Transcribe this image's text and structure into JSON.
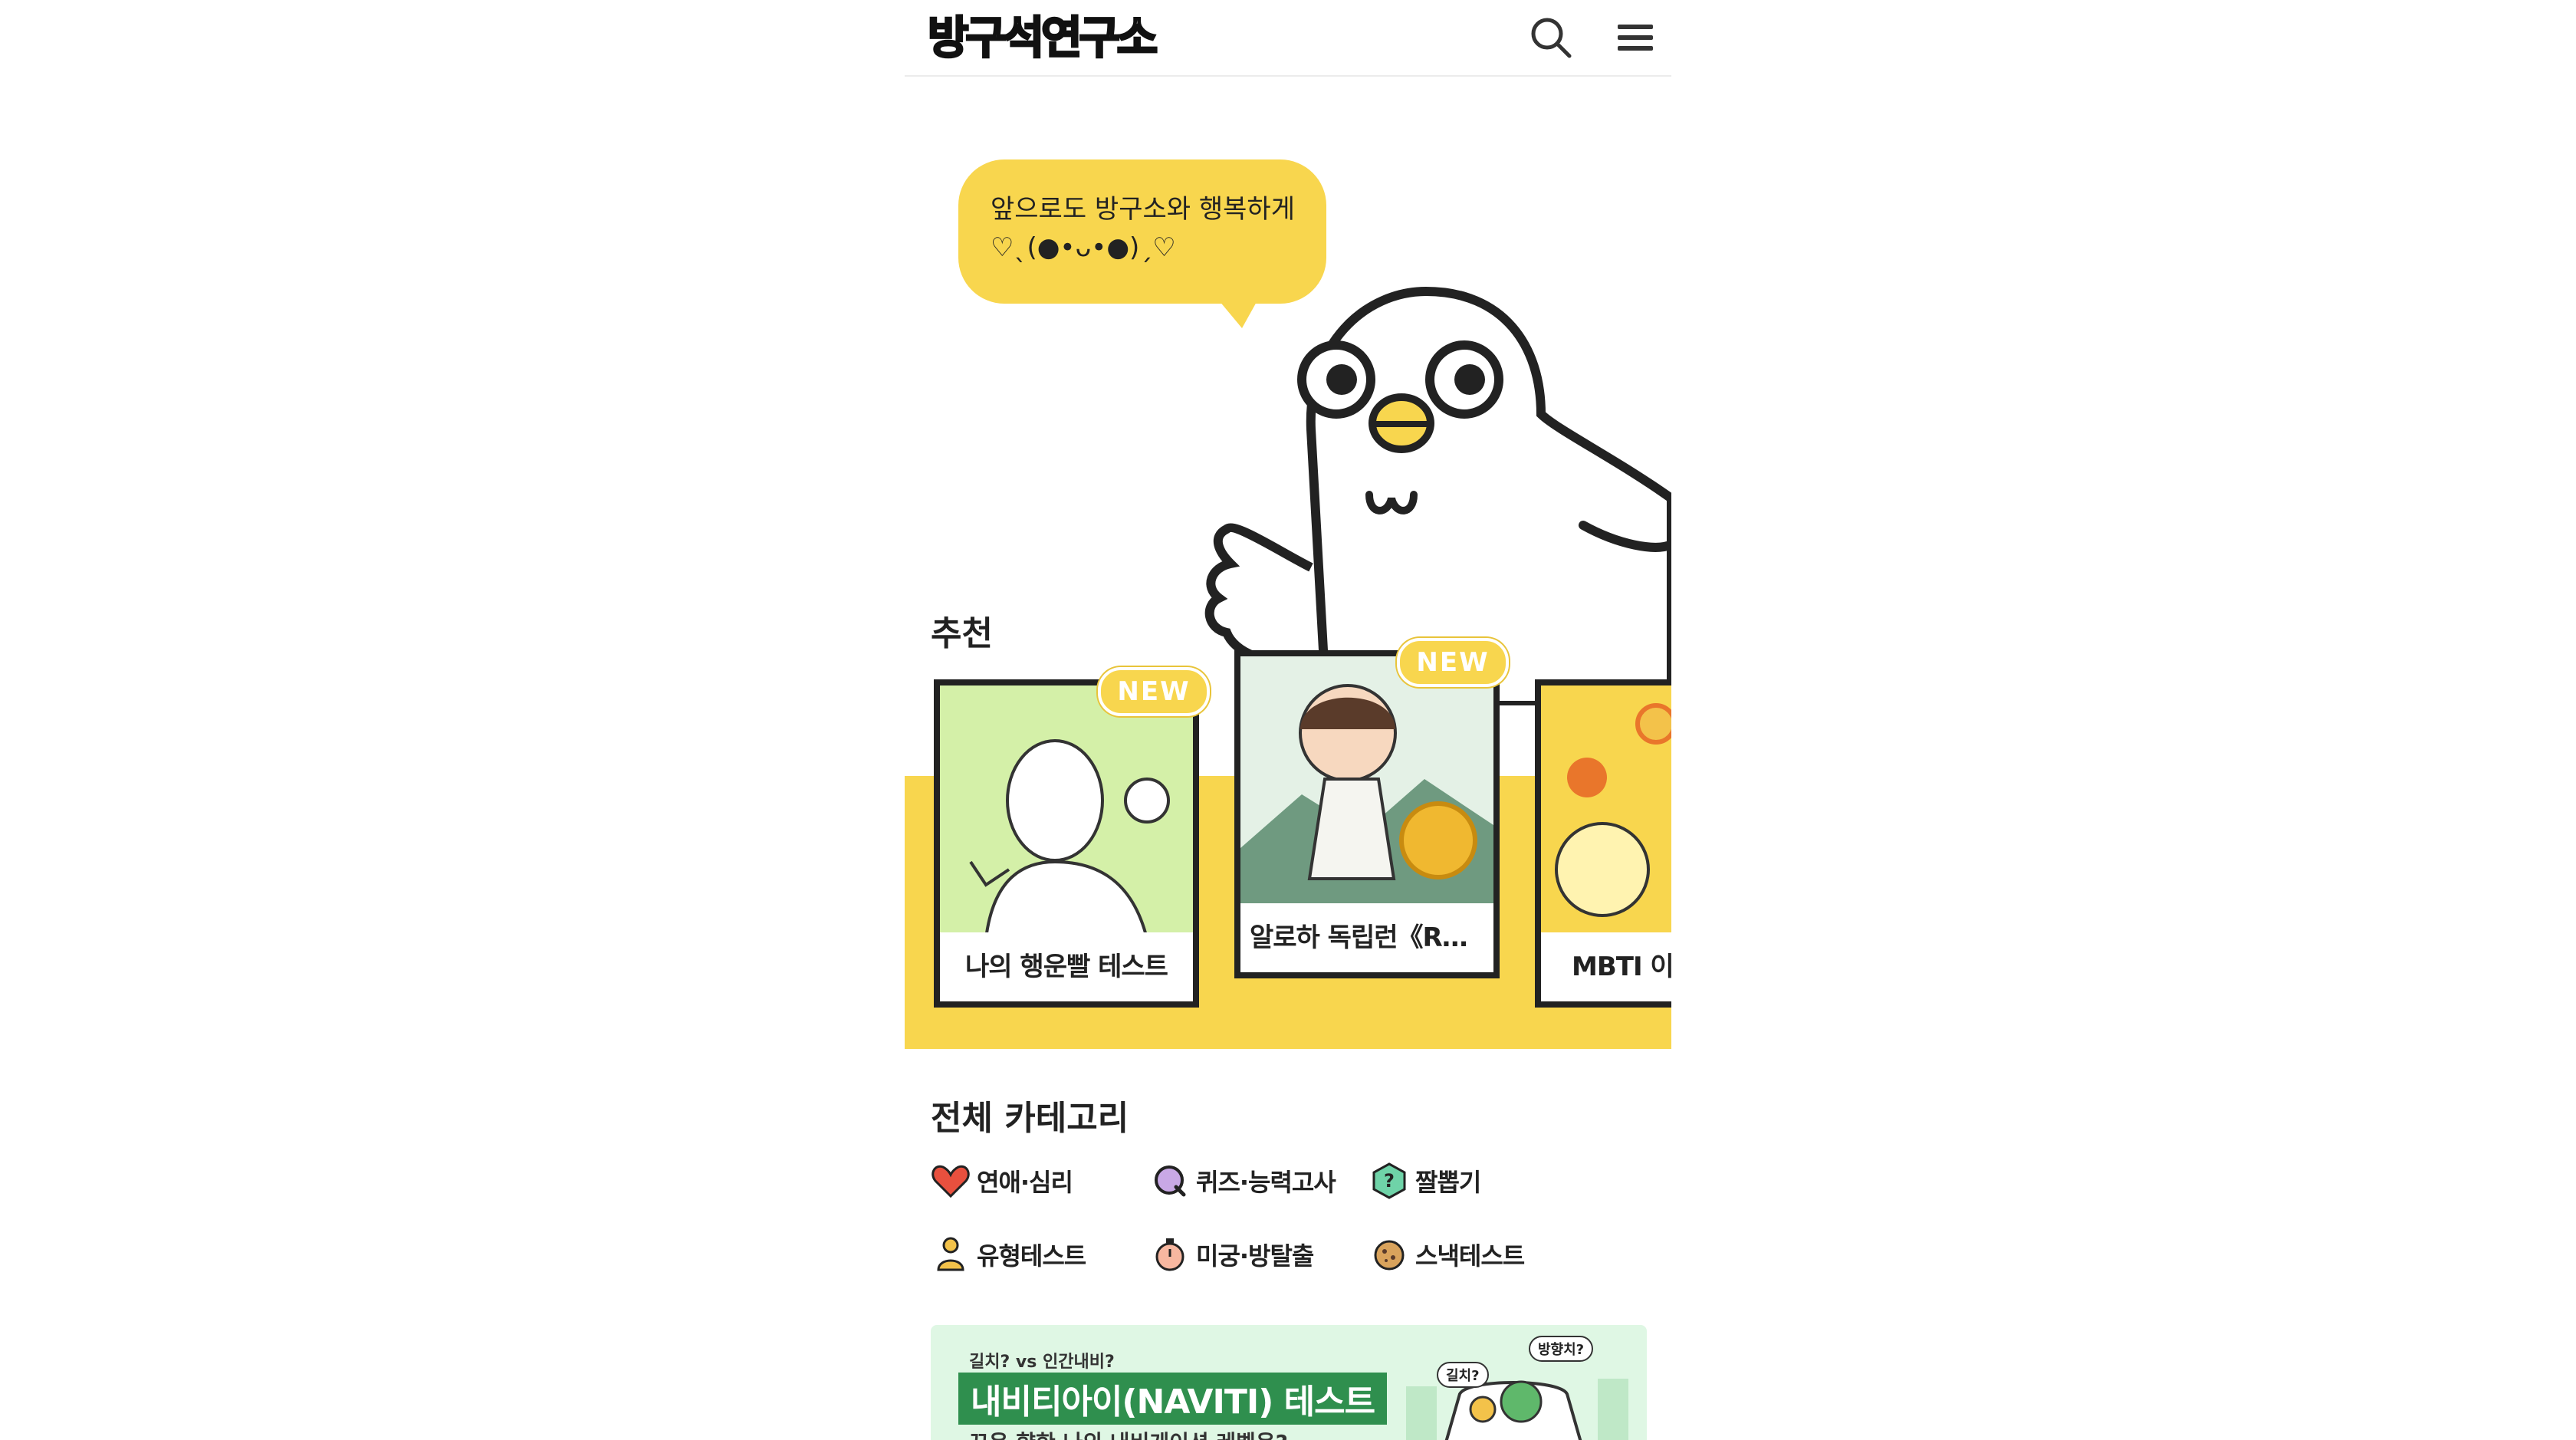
{
  "header": {
    "logo_text": "방구석연구소",
    "search_icon": "search-icon",
    "menu_icon": "hamburger-menu-icon"
  },
  "hero": {
    "bubble_line1": "앞으로도 방구소와 행복하게",
    "bubble_line2": "♡ˎ(●•ᴗ•●)ˏ♡",
    "mascot": "white-pigeon-mascot"
  },
  "recommend": {
    "title": "추천",
    "cards": [
      {
        "label": "나의 행운빨 테스트",
        "badge": "NEW"
      },
      {
        "label": "알로하 독립런《RU…",
        "badge": "NEW"
      },
      {
        "label": "MBTI 이미",
        "badge": ""
      }
    ]
  },
  "categories": {
    "title": "전체 카테고리",
    "items": [
      {
        "label": "연애·심리",
        "icon": "heart-icon"
      },
      {
        "label": "퀴즈·능력고사",
        "icon": "quiz-q-icon"
      },
      {
        "label": "짤뽑기",
        "icon": "question-hexagon-icon"
      },
      {
        "label": "유형테스트",
        "icon": "person-icon"
      },
      {
        "label": "미궁·방탈출",
        "icon": "stopwatch-icon"
      },
      {
        "label": "스낵테스트",
        "icon": "cookie-icon"
      }
    ]
  },
  "banner": {
    "subtitle": "길치? vs 인간내비?",
    "title": "내비티아이(NAVITI) 테스트",
    "description": "꼬은 향한 나의 내비게이션 레벨은?",
    "bubble1": "길치?",
    "bubble2": "방향치?"
  },
  "colors": {
    "accent_yellow": "#f8d64e",
    "banner_green": "#2f8f4e",
    "banner_bg": "#dff7e4"
  }
}
